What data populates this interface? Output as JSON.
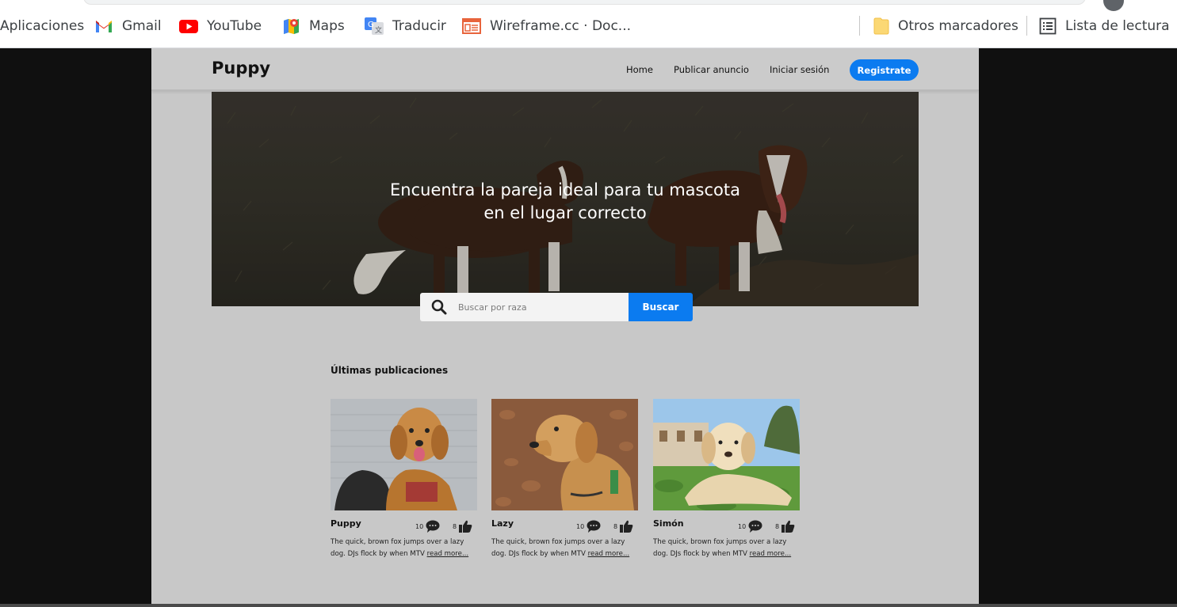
{
  "browser": {
    "bookmarks": [
      {
        "label": "Aplicaciones",
        "icon": "apps-grid-icon"
      },
      {
        "label": "Gmail",
        "icon": "gmail-icon"
      },
      {
        "label": "YouTube",
        "icon": "youtube-icon"
      },
      {
        "label": "Maps",
        "icon": "maps-icon"
      },
      {
        "label": "Traducir",
        "icon": "translate-icon"
      },
      {
        "label": "Wireframe.cc · Doc...",
        "icon": "wireframe-icon"
      },
      {
        "label": "Otros marcadores",
        "icon": "folder-icon"
      },
      {
        "label": "Lista de lectura",
        "icon": "reading-list-icon"
      }
    ]
  },
  "site": {
    "logo": "Puppy",
    "nav": {
      "home": "Home",
      "publish": "Publicar anuncio",
      "login": "Iniciar sesión",
      "register": "Registrate"
    },
    "hero": {
      "line1": "Encuentra la pareja ideal para tu mascota",
      "line2": "en el lugar correcto"
    },
    "search": {
      "placeholder": "Buscar por raza",
      "button": "Buscar"
    },
    "latest": {
      "title": "Últimas publicaciones",
      "cards": [
        {
          "name": "Puppy",
          "comments": "10",
          "likes": "8",
          "desc_line1": "The quick, brown fox jumps over a lazy",
          "desc_line2": "dog. DJs flock by when MTV",
          "read_more": "read more..."
        },
        {
          "name": "Lazy",
          "comments": "10",
          "likes": "8",
          "desc_line1": "The quick, brown fox jumps over a lazy",
          "desc_line2": "dog. DJs flock by when MTV",
          "read_more": "read more..."
        },
        {
          "name": "Simón",
          "comments": "10",
          "likes": "8",
          "desc_line1": "The quick, brown fox jumps over a lazy",
          "desc_line2": "dog. DJs flock by when MTV",
          "read_more": "read more..."
        }
      ]
    },
    "colors": {
      "accent": "#0b7bf0",
      "page_bg": "#c8c8c8",
      "outer_bg": "#101010"
    }
  }
}
